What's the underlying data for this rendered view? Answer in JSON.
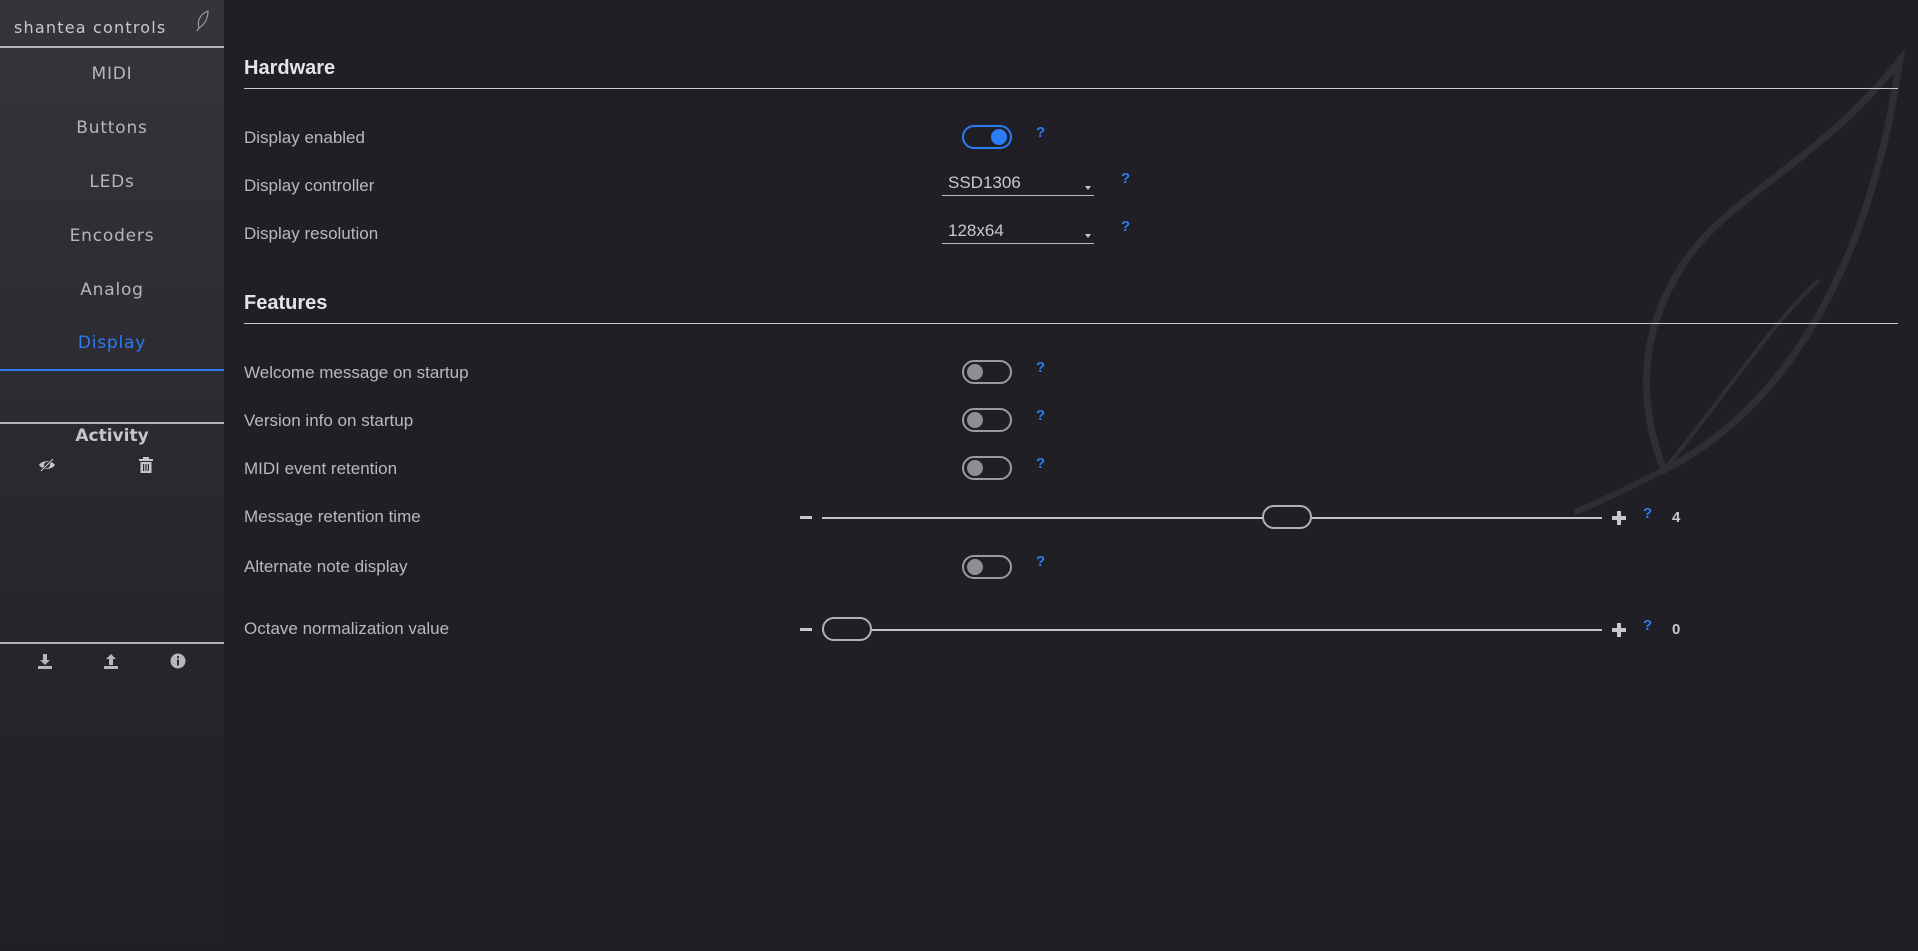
{
  "brand": {
    "name": "shantea controls"
  },
  "nav": [
    {
      "label": "MIDI",
      "active": false
    },
    {
      "label": "Buttons",
      "active": false
    },
    {
      "label": "LEDs",
      "active": false
    },
    {
      "label": "Encoders",
      "active": false
    },
    {
      "label": "Analog",
      "active": false
    },
    {
      "label": "Display",
      "active": true
    }
  ],
  "activity": {
    "title": "Activity",
    "icons": [
      "eye-off-icon",
      "trash-icon"
    ]
  },
  "footer_icons": [
    "download-icon",
    "upload-icon",
    "info-icon"
  ],
  "help_text": "?",
  "sections": {
    "hardware": {
      "title": "Hardware",
      "display_enabled": {
        "label": "Display enabled",
        "on": true
      },
      "display_controller": {
        "label": "Display controller",
        "value": "SSD1306"
      },
      "display_resolution": {
        "label": "Display resolution",
        "value": "128x64"
      }
    },
    "features": {
      "title": "Features",
      "welcome_message": {
        "label": "Welcome message on startup",
        "on": false
      },
      "version_info": {
        "label": "Version info on startup",
        "on": false
      },
      "midi_event_retention": {
        "label": "MIDI event retention",
        "on": false
      },
      "message_retention_time": {
        "label": "Message retention time",
        "value": "4",
        "fraction": 0.603
      },
      "alternate_note_display": {
        "label": "Alternate note display",
        "on": false
      },
      "octave_normalization": {
        "label": "Octave normalization value",
        "value": "0",
        "fraction": 0.0
      }
    }
  },
  "colors": {
    "accent": "#2b7cf5",
    "background": "#1f1f25",
    "sidebar_top": "#34343a",
    "text": "#b9b9bd",
    "heading": "#e4e4e8"
  }
}
